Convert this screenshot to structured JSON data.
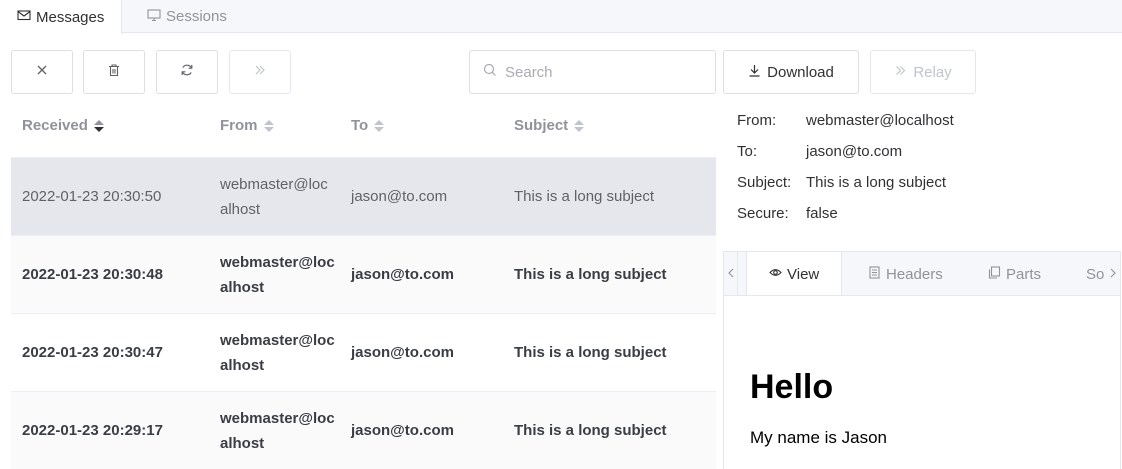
{
  "top_tabs": [
    {
      "label": "Messages",
      "icon": "envelope-icon",
      "active": true
    },
    {
      "label": "Sessions",
      "icon": "monitor-icon",
      "active": false
    }
  ],
  "toolbar": {
    "clear_icon": "close-icon",
    "delete_icon": "trash-icon",
    "refresh_icon": "refresh-icon",
    "forward_icon": "double-chevron-right-icon",
    "search_placeholder": "Search",
    "search_value": "",
    "download_label": "Download",
    "relay_label": "Relay"
  },
  "table": {
    "headers": {
      "received": "Received",
      "from": "From",
      "to": "To",
      "subject": "Subject"
    },
    "sort": {
      "column": "received",
      "direction": "desc"
    },
    "rows": [
      {
        "received": "2022-01-23 20:30:50",
        "from": "webmaster@localhost",
        "to": "jason@to.com",
        "subject": "This is a long subject",
        "selected": true,
        "unread": false
      },
      {
        "received": "2022-01-23 20:30:48",
        "from": "webmaster@localhost",
        "to": "jason@to.com",
        "subject": "This is a long subject",
        "selected": false,
        "unread": true
      },
      {
        "received": "2022-01-23 20:30:47",
        "from": "webmaster@localhost",
        "to": "jason@to.com",
        "subject": "This is a long subject",
        "selected": false,
        "unread": true
      },
      {
        "received": "2022-01-23 20:29:17",
        "from": "webmaster@localhost",
        "to": "jason@to.com",
        "subject": "This is a long subject",
        "selected": false,
        "unread": true
      }
    ]
  },
  "detail": {
    "from_label": "From:",
    "from_value": "webmaster@localhost",
    "to_label": "To:",
    "to_value": "jason@to.com",
    "subject_label": "Subject:",
    "subject_value": "This is a long subject",
    "secure_label": "Secure:",
    "secure_value": "false"
  },
  "preview": {
    "tabs": [
      {
        "label": "View",
        "icon": "eye-icon",
        "active": true
      },
      {
        "label": "Headers",
        "icon": "document-icon",
        "active": false
      },
      {
        "label": "Parts",
        "icon": "copy-icon",
        "active": false
      },
      {
        "label": "So",
        "icon": "",
        "active": false
      }
    ],
    "heading": "Hello",
    "paragraph": "My name is Jason"
  },
  "colors": {
    "accent": "#303133",
    "selected_row": "#e6e7ec",
    "border": "#dcdfe6"
  }
}
